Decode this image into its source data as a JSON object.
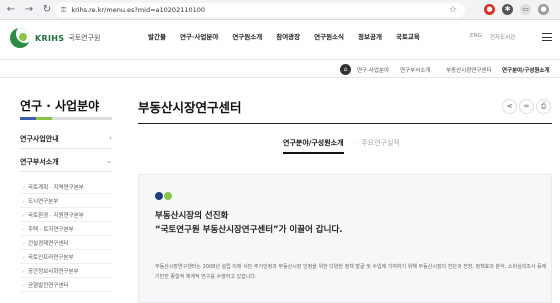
{
  "browser": {
    "url": "krihs.re.kr/menu.es?mid=a10202110100"
  },
  "header": {
    "logo_text": "KRIHS",
    "logo_sub": "국토연구원",
    "nav": [
      "발간물",
      "연구·사업분야",
      "연구원소개",
      "참여광장",
      "연구원소식",
      "정보공개",
      "국토교육"
    ],
    "util": [
      "ENG",
      "전자도서관"
    ]
  },
  "breadcrumb": {
    "items": [
      "연구·사업분야",
      "연구부서소개",
      "부동산시장연구센터"
    ],
    "current": "연구분야/구성원소개"
  },
  "sidebar": {
    "title": "연구 · 사업분야",
    "items": [
      {
        "label": "연구사업안내",
        "arrow": "›"
      },
      {
        "label": "연구부서소개",
        "arrow": "⌄"
      }
    ],
    "sub_items": [
      "국토계획 · 지역연구본부",
      "도시연구본부",
      "국토환경 · 자원연구본부",
      "주택 · 토지연구본부",
      "건설경제연구센터",
      "국토인프라연구본부",
      "공간정보사회연구본부",
      "균형발전연구센터"
    ]
  },
  "main": {
    "title": "부동산시장연구센터",
    "tabs": [
      {
        "label": "연구분야/구성원소개",
        "active": true
      },
      {
        "label": "주요연구실적",
        "active": false
      }
    ],
    "lead_line1": "부동산시장의 선진화",
    "lead_line2": "“국토연구원 부동산시장연구센터”가 이끌어 갑니다.",
    "body": "부동산시장연구센터는 2008년 설립 이래 서민 주거안정과 부동산시장 안정을 위한 다양한 정책 발굴 및 수입에 기여하기 위해 부동산시장의 진단과 전망, 정책효과 분석, 소비심리조사 등에 기반한 종합적 체계적 연구를 수행하고 있습니다."
  },
  "colors": {
    "brand_green": "#2c8a45",
    "light_green": "#8bc34a",
    "blue": "#3b5ea8",
    "dark_blue": "#1f3f7a"
  }
}
